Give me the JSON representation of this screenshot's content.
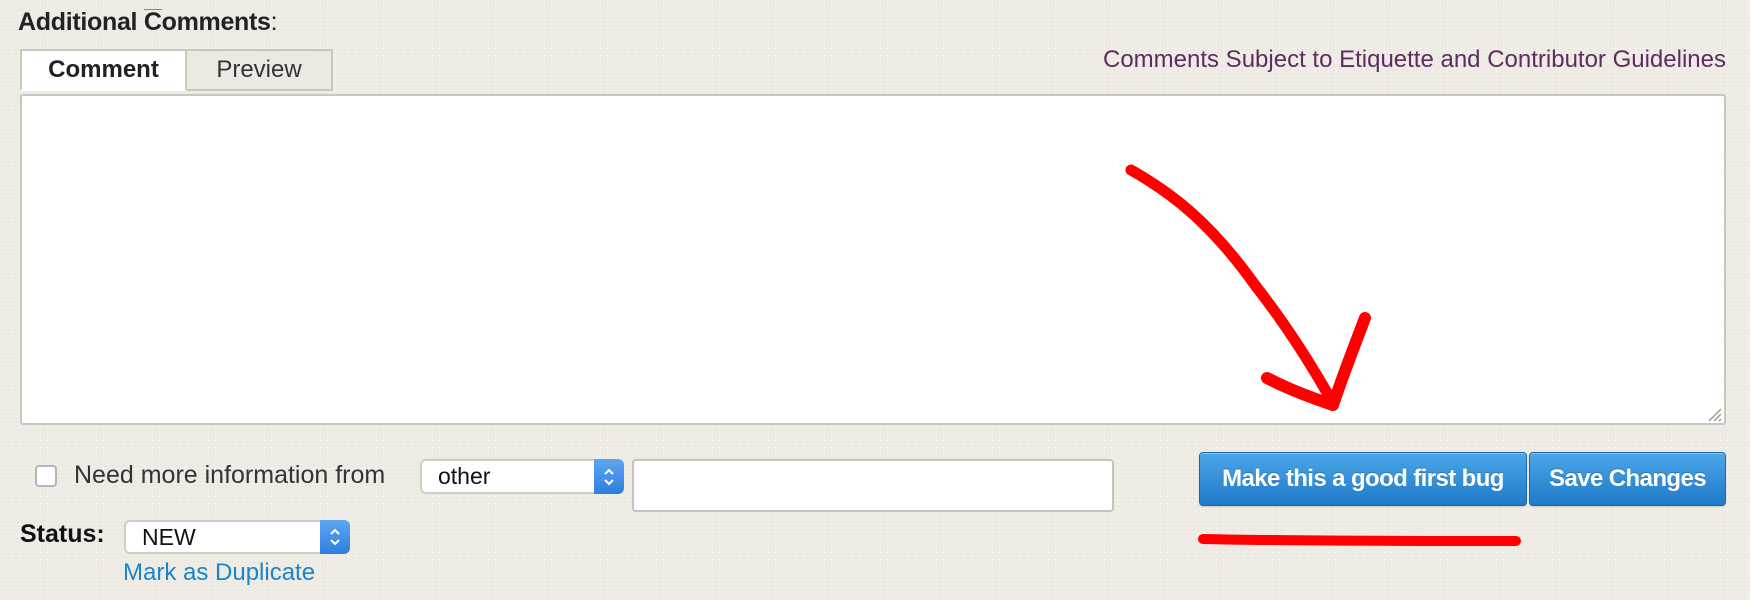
{
  "comments": {
    "heading_a": "Additional ",
    "heading_cue": "C",
    "heading_b": "omments",
    "heading_colon": ":",
    "tabs": [
      {
        "label": "Comment",
        "active": true
      },
      {
        "label": "Preview",
        "active": false
      }
    ],
    "guidelines_link": "Comments Subject to Etiquette and Contributor Guidelines",
    "textarea_value": ""
  },
  "needinfo": {
    "label": "Need more information from",
    "checked": false,
    "select_value": "other",
    "text_value": ""
  },
  "actions": {
    "good_first_bug": "Make this a good first bug",
    "save_changes": "Save Changes"
  },
  "status": {
    "label": "Status:",
    "value": "NEW",
    "mark_duplicate": "Mark as Duplicate"
  },
  "colors": {
    "annotation": "#ff0000",
    "button": "#2b8ad8",
    "link": "#1a84cc",
    "guidelines_link": "#5c2d5e"
  },
  "icons": {
    "select_stepper": "up-down-chevron-icon",
    "resize": "resize-grip-icon",
    "annotation": "red-arrow-annotation"
  }
}
